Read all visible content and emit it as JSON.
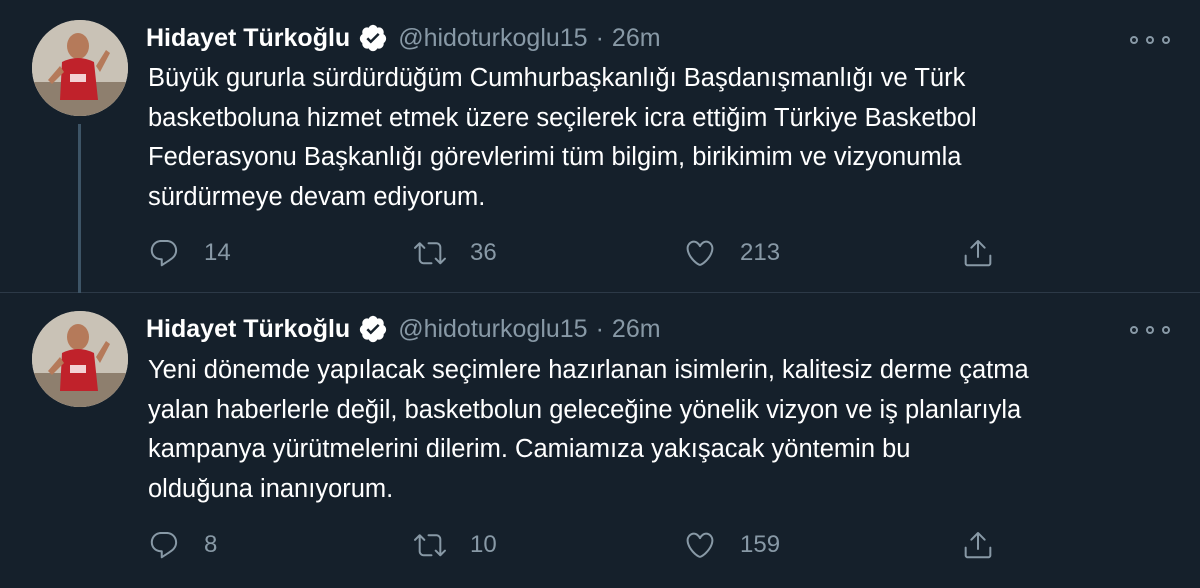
{
  "colors": {
    "background": "#15202b",
    "text_primary": "#ffffff",
    "text_secondary": "#8899a6",
    "verified_badge": "#ffffff",
    "divider": "#2c3947",
    "thread_line": "#3d5466"
  },
  "icons": {
    "verified": "verified-badge-icon",
    "more": "more-dots-icon",
    "reply": "speech-bubble-icon",
    "retweet": "retweet-arrows-icon",
    "like": "heart-icon",
    "share": "share-arrow-up-icon"
  },
  "tweets": [
    {
      "author_name": "Hidayet Türkoğlu",
      "handle": "@hidoturkoglu15",
      "separator": "·",
      "time": "26m",
      "lines": [
        "Büyük gururla sürdürdüğüm Cumhurbaşkanlığı Başdanışmanlığı ve Türk",
        "basketboluna hizmet etmek üzere seçilerek icra ettiğim Türkiye Basketbol",
        "Federasyonu Başkanlığı görevlerimi tüm bilgim, birikimim ve vizyonumla",
        "sürdürmeye devam ediyorum."
      ],
      "replies": "14",
      "retweets": "36",
      "likes": "213"
    },
    {
      "author_name": "Hidayet Türkoğlu",
      "handle": "@hidoturkoglu15",
      "separator": "·",
      "time": "26m",
      "lines": [
        "Yeni dönemde yapılacak seçimlere hazırlanan isimlerin, kalitesiz derme çatma",
        "yalan haberlerle değil, basketbolun geleceğine yönelik vizyon ve iş planlarıyla",
        "kampanya yürütmelerini dilerim. Camiamıza yakışacak yöntemin bu",
        "olduğuna inanıyorum."
      ],
      "replies": "8",
      "retweets": "10",
      "likes": "159"
    }
  ]
}
